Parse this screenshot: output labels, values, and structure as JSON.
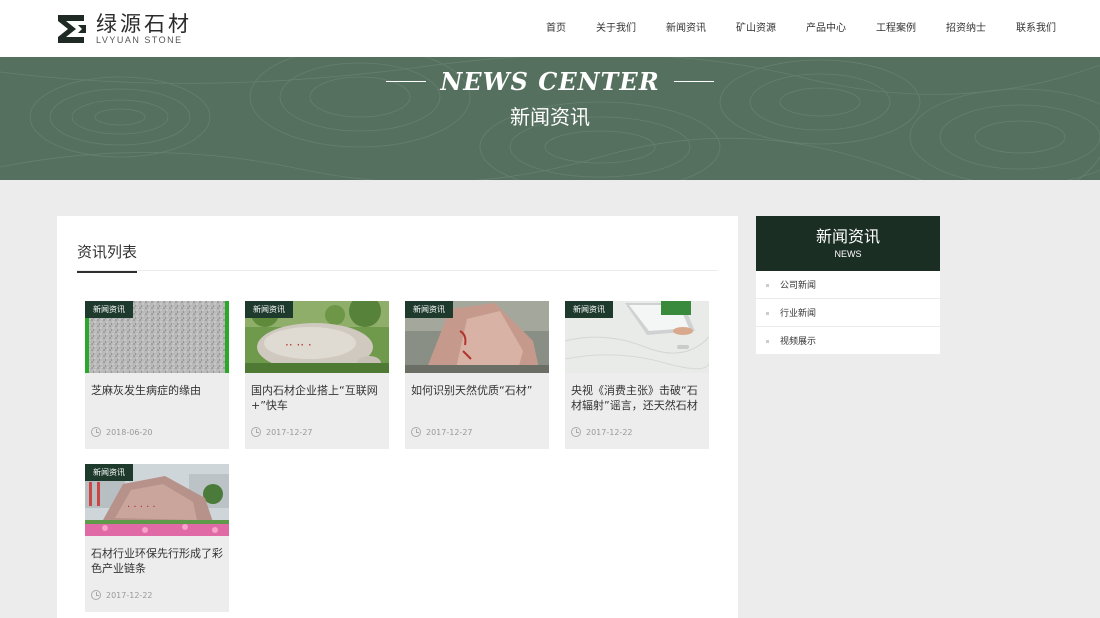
{
  "brand": {
    "name_cn": "绿源石材",
    "name_en": "LVYUAN STONE"
  },
  "nav": [
    "首页",
    "关于我们",
    "新闻资讯",
    "矿山资源",
    "产品中心",
    "工程案例",
    "招资纳士",
    "联系我们"
  ],
  "banner": {
    "title_en": "NEWS CENTER",
    "title_cn": "新闻资讯"
  },
  "main": {
    "section_title": "资讯列表",
    "articles": [
      {
        "tag": "新闻资讯",
        "title": "芝麻灰发生病症的缘由",
        "date": "2018-06-20",
        "image": "granite-texture"
      },
      {
        "tag": "新闻资讯",
        "title": "国内石材企业搭上“互联网+”快车",
        "date": "2017-12-27",
        "image": "inscribed-rock-garden"
      },
      {
        "tag": "新闻资讯",
        "title": "如何识别天然优质“石材”",
        "date": "2017-12-27",
        "image": "red-inscribed-rock"
      },
      {
        "tag": "新闻资讯",
        "title": "央视《消费主张》击破“石材辐射”谣言，还天然石材",
        "date": "2017-12-22",
        "image": "marble-desk-laptop"
      },
      {
        "tag": "新闻资讯",
        "title": "石材行业环保先行形成了彩色产业链条",
        "date": "2017-12-22",
        "image": "rock-with-flowers"
      }
    ]
  },
  "sidebar": {
    "title_cn": "新闻资讯",
    "title_en": "NEWS",
    "items": [
      "公司新闻",
      "行业新闻",
      "视频展示"
    ]
  },
  "colors": {
    "banner": "#56705f",
    "dark_green": "#1b2e24",
    "tag": "#1d3a2c",
    "page_bg": "#ececec"
  }
}
